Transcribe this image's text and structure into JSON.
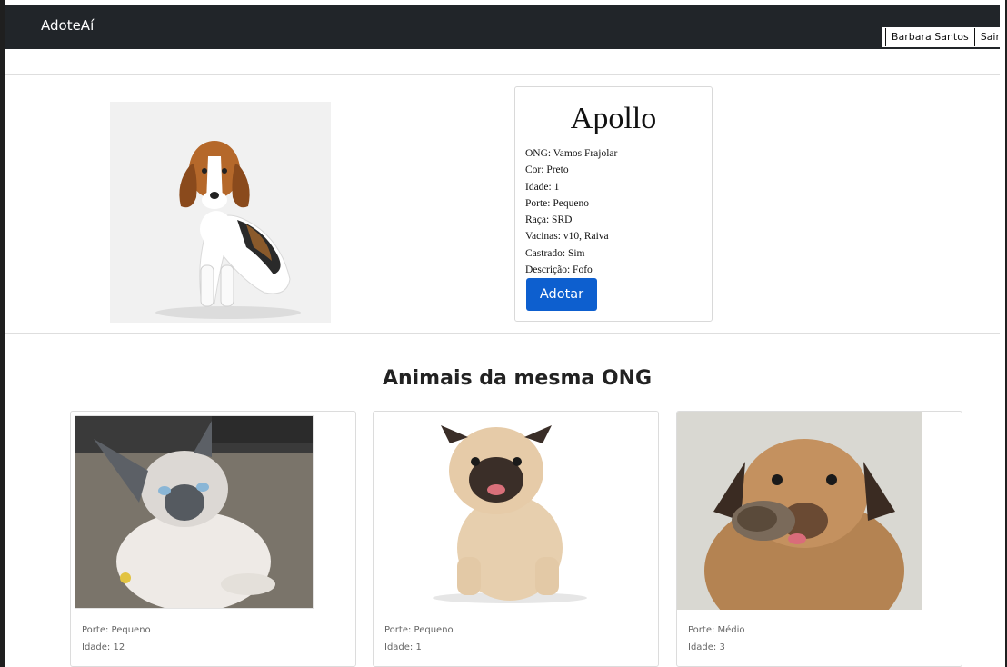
{
  "navbar": {
    "brand": "AdoteAí",
    "user_name": "Barbara Santos",
    "logout": "Sair"
  },
  "pet": {
    "name": "Apollo",
    "details": [
      "ONG: Vamos Frajolar",
      "Cor: Preto",
      "Idade: 1",
      "Porte: Pequeno",
      "Raça: SRD",
      "Vacinas: v10, Raiva",
      "Castrado: Sim",
      "Descrição: Fofo"
    ],
    "adopt_label": "Adotar"
  },
  "related": {
    "title": "Animais da mesma ONG",
    "cards": [
      {
        "porte": "Porte: Pequeno",
        "idade": "Idade: 12"
      },
      {
        "porte": "Porte: Pequeno",
        "idade": "Idade: 1"
      },
      {
        "porte": "Porte: Médio",
        "idade": "Idade: 3"
      }
    ]
  },
  "colors": {
    "navbar": "#212529",
    "button": "#0d5fcf"
  }
}
